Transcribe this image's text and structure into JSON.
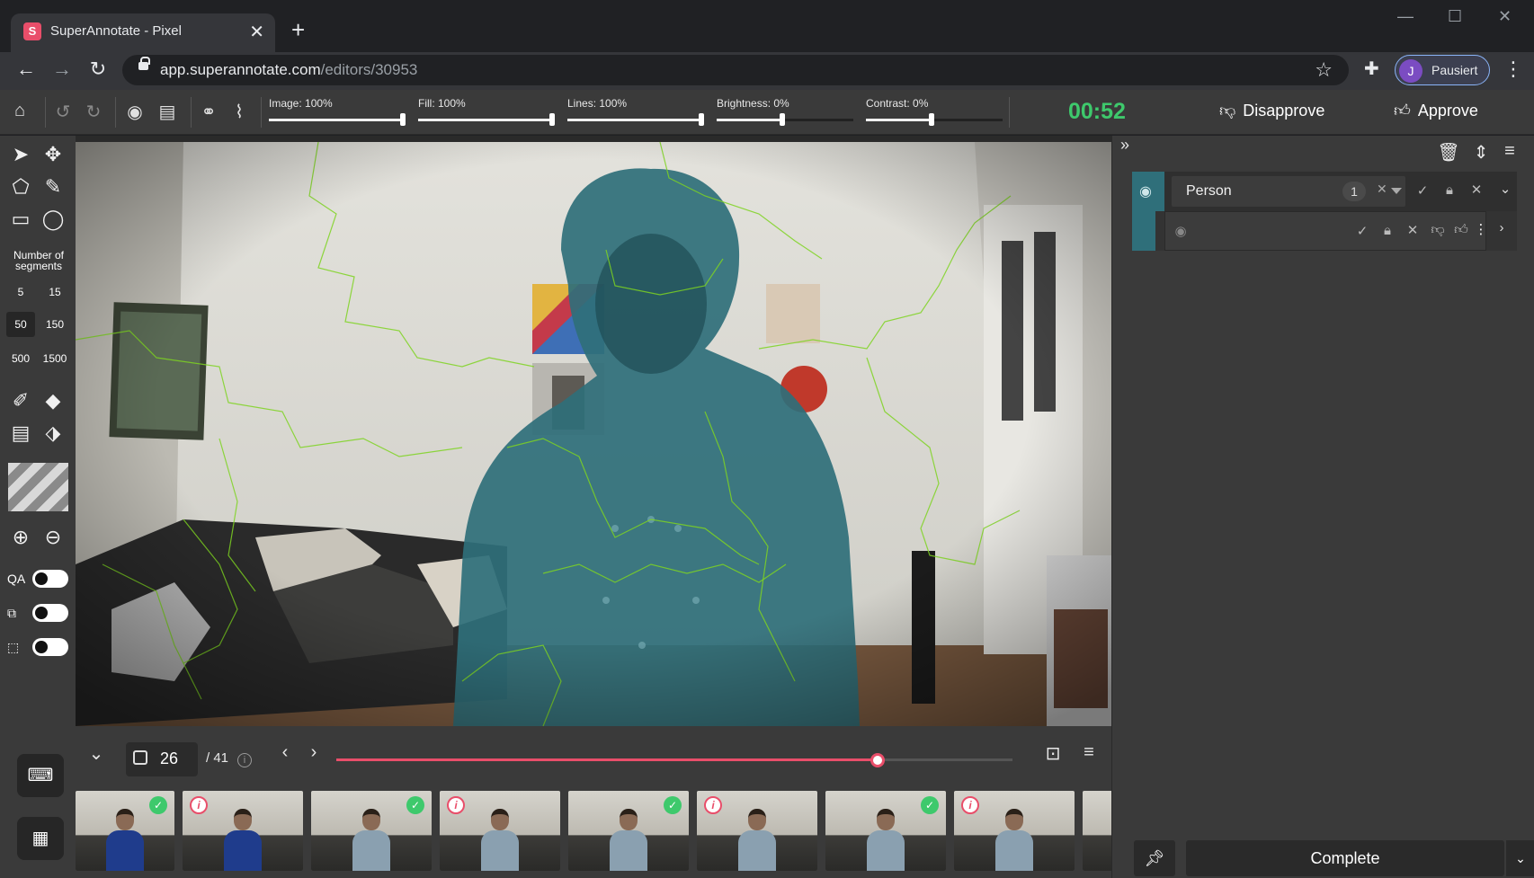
{
  "browser": {
    "tab_title": "SuperAnnotate - Pixel",
    "tab_favicon_letter": "S",
    "url_domain": "app.superannotate.com",
    "url_path": "/editors/30953",
    "profile_initial": "J",
    "profile_name": "Pausiert"
  },
  "toolbar": {
    "sliders": [
      {
        "label": "Image: 100%",
        "value": 1.0
      },
      {
        "label": "Fill: 100%",
        "value": 1.0
      },
      {
        "label": "Lines: 100%",
        "value": 1.0
      },
      {
        "label": "Brightness: 0%",
        "value": 0.5
      },
      {
        "label": "Contrast: 0%",
        "value": 0.5
      }
    ],
    "timer": "00:52",
    "disapprove_label": "Disapprove",
    "approve_label": "Approve"
  },
  "left_panel": {
    "segments_title": "Number of segments",
    "segment_options": [
      "5",
      "15",
      "50",
      "150",
      "500",
      "1500"
    ],
    "active_segment": "50",
    "qa_label": "QA"
  },
  "frame_nav": {
    "current_frame": "26",
    "total_frames": "/ 41",
    "progress": 0.8
  },
  "thumbnails": [
    {
      "status": "approved",
      "shirt": "blue"
    },
    {
      "status": "info",
      "shirt": "blue"
    },
    {
      "status": "approved",
      "shirt": "grey"
    },
    {
      "status": "info",
      "shirt": "grey"
    },
    {
      "status": "approved",
      "shirt": "grey"
    },
    {
      "status": "info",
      "shirt": "grey"
    },
    {
      "status": "approved",
      "shirt": "grey"
    },
    {
      "status": "info",
      "shirt": "grey"
    },
    {
      "status": "approved",
      "shirt": "grey"
    }
  ],
  "right_panel": {
    "class_name": "Person",
    "class_count": "1",
    "complete_label": "Complete"
  },
  "colors": {
    "accent": "#e94e6a",
    "timer_green": "#3ec96c",
    "person_mask": "#2f6f7a",
    "segment_outline": "#7ed321"
  }
}
